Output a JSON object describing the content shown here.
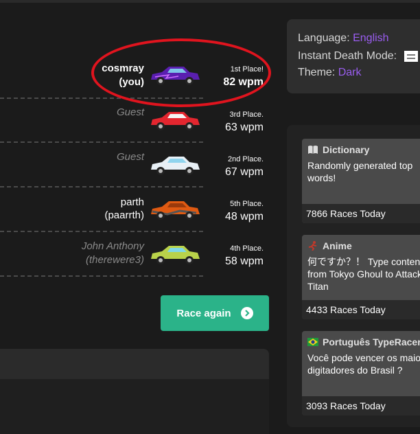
{
  "racers": [
    {
      "name": "cosmray",
      "handle": "(you)",
      "type": "user",
      "car_color": "#5a1fb0",
      "place": "1st Place!",
      "wpm": "82 wpm"
    },
    {
      "name": "Guest",
      "handle": "",
      "type": "guest",
      "car_color": "#e3262f",
      "place": "3rd Place.",
      "wpm": "63 wpm"
    },
    {
      "name": "Guest",
      "handle": "",
      "type": "guest",
      "car_color": "#e8f0f6",
      "place": "2nd Place.",
      "wpm": "67 wpm"
    },
    {
      "name": "parth",
      "handle": "(paarrth)",
      "type": "user",
      "car_color": "#e05a12",
      "place": "5th Place.",
      "wpm": "48 wpm"
    },
    {
      "name": "John Anthony",
      "handle": "(therewere3)",
      "type": "guest",
      "car_color": "#b9d24a",
      "place": "4th Place.",
      "wpm": "58 wpm"
    }
  ],
  "race_again_label": "Race again",
  "settings": {
    "language_label": "Language:",
    "language_value": "English",
    "instant_death_label": "Instant Death Mode:",
    "theme_label": "Theme:",
    "theme_value": "Dark"
  },
  "modes": [
    {
      "icon": "book-icon",
      "title": "Dictionary",
      "desc": "Randomly generated top words!",
      "races": "7866 Races Today"
    },
    {
      "icon": "running-figure-icon",
      "title": "Anime",
      "desc": "何ですか？！ Type content from Tokyo Ghoul to Attack on Titan",
      "races": "4433 Races Today"
    },
    {
      "icon": "brazil-flag-icon",
      "title": "Português TypeRacer",
      "desc": "Você pode vencer os maiores digitadores do Brasil ?",
      "races": "3093 Races Today"
    }
  ],
  "colors": {
    "accent_green": "#2bb389",
    "accent_purple": "#9a5df0",
    "highlight_red": "#e0141e"
  }
}
